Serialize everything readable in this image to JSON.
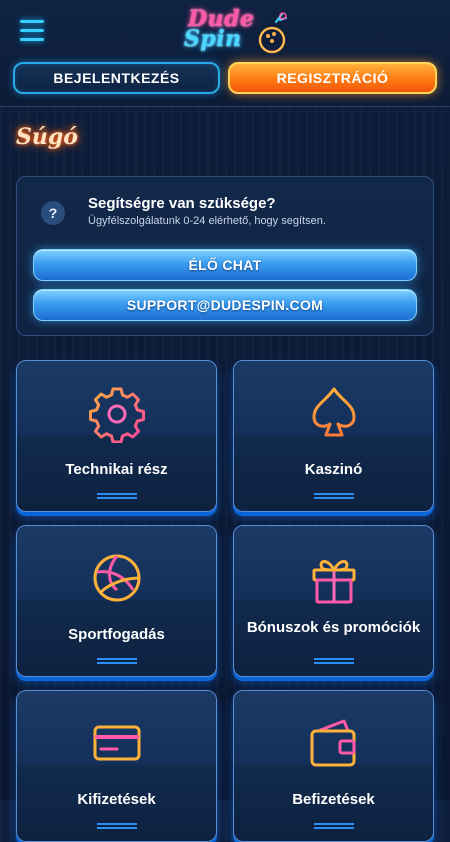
{
  "header": {
    "logo_line1": "Dude",
    "logo_line2": "Spin",
    "login_label": "BEJELENTKEZÉS",
    "register_label": "REGISZTRÁCIÓ"
  },
  "page": {
    "title": "Súgó"
  },
  "help": {
    "icon_text": "?",
    "title": "Segítségre van szüksége?",
    "subtitle": "Ügyfélszolgálatunk 0-24 elérhető, hogy segítsen.",
    "chat_label": "ÉLŐ CHAT",
    "email_label": "SUPPORT@DUDESPIN.COM"
  },
  "categories": [
    {
      "label": "Technikai rész",
      "icon": "gear-icon"
    },
    {
      "label": "Kaszinó",
      "icon": "spade-icon"
    },
    {
      "label": "Sportfogadás",
      "icon": "volleyball-icon"
    },
    {
      "label": "Bónuszok és promóciók",
      "icon": "gift-icon"
    },
    {
      "label": "Kifizetések",
      "icon": "credit-card-icon"
    },
    {
      "label": "Befizetések",
      "icon": "wallet-icon"
    }
  ],
  "colors": {
    "accent_blue": "#2aa9e8",
    "accent_orange": "#ff7a12",
    "neon_pink": "#ff3fa0",
    "neon_orange": "#ffb23a",
    "background": "#0b1a33"
  }
}
